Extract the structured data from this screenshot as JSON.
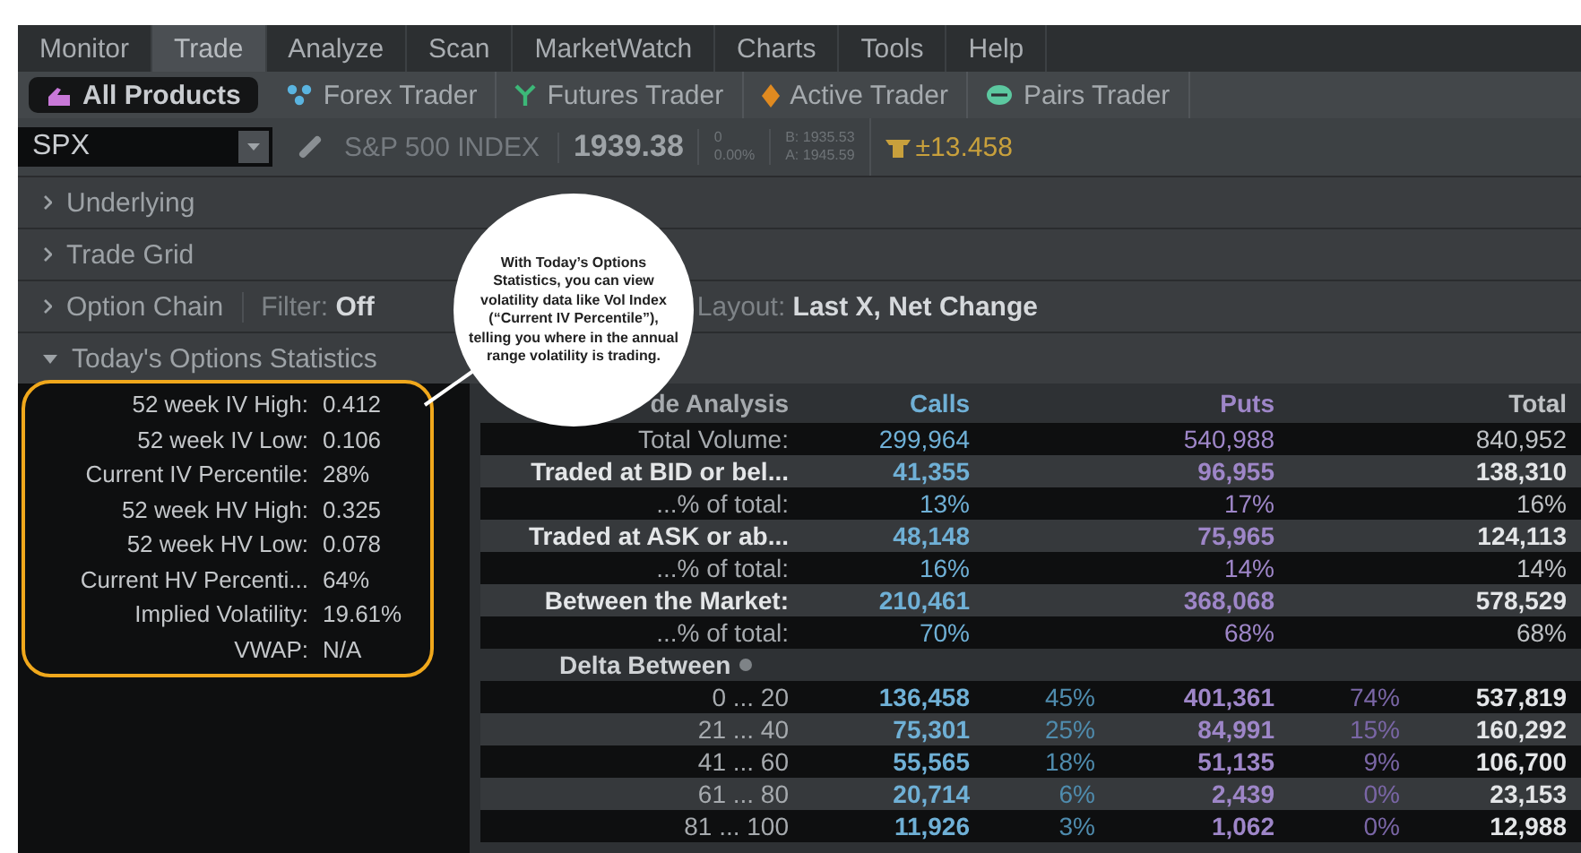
{
  "menu": [
    {
      "label": "Monitor",
      "selected": false
    },
    {
      "label": "Trade",
      "selected": true
    },
    {
      "label": "Analyze",
      "selected": false
    },
    {
      "label": "Scan",
      "selected": false
    },
    {
      "label": "MarketWatch",
      "selected": false
    },
    {
      "label": "Charts",
      "selected": false
    },
    {
      "label": "Tools",
      "selected": false
    },
    {
      "label": "Help",
      "selected": false
    }
  ],
  "products": [
    {
      "label": "All Products",
      "selected": true
    },
    {
      "label": "Forex Trader",
      "selected": false
    },
    {
      "label": "Futures Trader",
      "selected": false
    },
    {
      "label": "Active Trader",
      "selected": false
    },
    {
      "label": "Pairs Trader",
      "selected": false
    }
  ],
  "symbol": {
    "value": "SPX",
    "description": "S&P 500 INDEX",
    "last": "1939.38",
    "change": "0",
    "change_pct": "0.00%",
    "bid": "B: 1935.53",
    "ask": "A: 1945.59",
    "expected_move": "±13.458"
  },
  "sections": [
    {
      "title": "Underlying",
      "expanded": false
    },
    {
      "title": "Trade Grid",
      "expanded": false
    },
    {
      "title": "Option Chain",
      "expanded": false,
      "filter_label": "Filter:",
      "filter_value": "Off",
      "layout_label": "Layout:",
      "layout_value": "Last X, Net Change"
    },
    {
      "title": "Today's Options Statistics",
      "expanded": true
    }
  ],
  "stats": [
    {
      "label": "52 week IV High:",
      "value": "0.412"
    },
    {
      "label": "52 week IV Low:",
      "value": "0.106"
    },
    {
      "label": "Current IV Percentile:",
      "value": "28%"
    },
    {
      "label": "52 week HV High:",
      "value": "0.325"
    },
    {
      "label": "52 week HV Low:",
      "value": "0.078"
    },
    {
      "label": "Current HV Percenti...",
      "value": "64%"
    },
    {
      "label": "Implied Volatility:",
      "value": "19.61%"
    },
    {
      "label": "VWAP:",
      "value": "N/A"
    }
  ],
  "trade_analysis": {
    "columns": [
      "de Analysis",
      "Calls",
      "Puts",
      "Total"
    ],
    "rows": [
      {
        "kind": "plain",
        "label": "Total Volume:",
        "calls": "299,964",
        "puts": "540,988",
        "total": "840,952"
      },
      {
        "kind": "bold",
        "label": "Traded at BID or bel...",
        "calls": "41,355",
        "puts": "96,955",
        "total": "138,310"
      },
      {
        "kind": "plain",
        "label": "...% of total:",
        "calls": "13%",
        "puts": "17%",
        "total": "16%"
      },
      {
        "kind": "bold",
        "label": "Traded at ASK or ab...",
        "calls": "48,148",
        "puts": "75,965",
        "total": "124,113"
      },
      {
        "kind": "plain",
        "label": "...% of total:",
        "calls": "16%",
        "puts": "14%",
        "total": "14%"
      },
      {
        "kind": "bold",
        "label": "Between the Market:",
        "calls": "210,461",
        "puts": "368,068",
        "total": "578,529"
      },
      {
        "kind": "plain",
        "label": "...% of total:",
        "calls": "70%",
        "puts": "68%",
        "total": "68%"
      },
      {
        "kind": "group",
        "label": "Delta Between"
      },
      {
        "kind": "delta",
        "label": "0 ... 20",
        "calls": "136,458",
        "calls_pct": "45%",
        "puts": "401,361",
        "puts_pct": "74%",
        "total": "537,819"
      },
      {
        "kind": "delta",
        "label": "21 ... 40",
        "calls": "75,301",
        "calls_pct": "25%",
        "puts": "84,991",
        "puts_pct": "15%",
        "total": "160,292"
      },
      {
        "kind": "delta",
        "label": "41 ... 60",
        "calls": "55,565",
        "calls_pct": "18%",
        "puts": "51,135",
        "puts_pct": "9%",
        "total": "106,700"
      },
      {
        "kind": "delta",
        "label": "61 ... 80",
        "calls": "20,714",
        "calls_pct": "6%",
        "puts": "2,439",
        "puts_pct": "0%",
        "total": "23,153"
      },
      {
        "kind": "delta",
        "label": "81 ... 100",
        "calls": "11,926",
        "calls_pct": "3%",
        "puts": "1,062",
        "puts_pct": "0%",
        "total": "12,988"
      }
    ]
  },
  "callout": {
    "text": "With Today’s Options Statistics, you can view volatility data like Vol Index (“Current IV Percentile”), telling you where in the annual range volatility is trading."
  }
}
